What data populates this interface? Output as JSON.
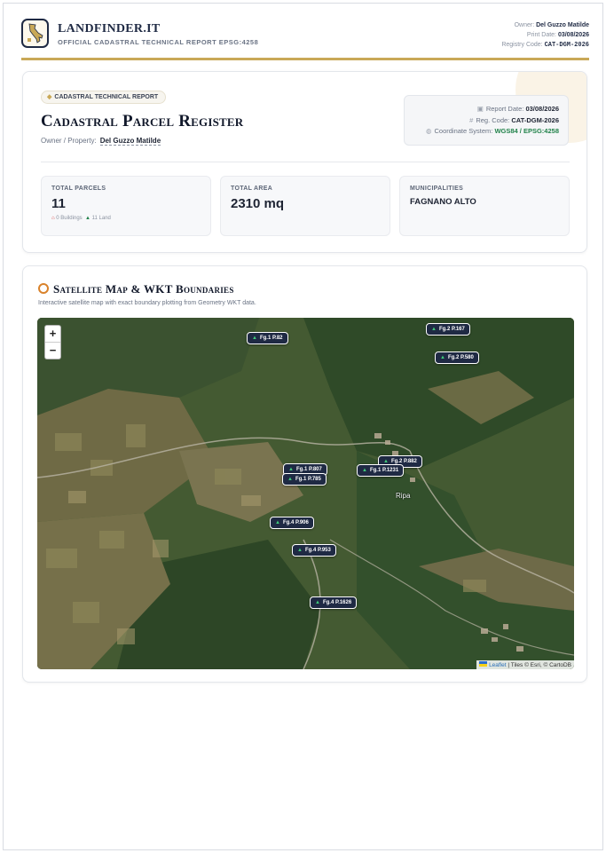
{
  "header": {
    "brand": "LANDFINDER.IT",
    "subtitle": "OFFICIAL CADASTRAL TECHNICAL REPORT EPSG:4258",
    "owner_label": "Owner:",
    "owner_value": "Del Guzzo Matilde",
    "print_label": "Print Date:",
    "print_value": "03/08/2026",
    "registry_label": "Registry Code:",
    "registry_value": "CAT-DGM-2026"
  },
  "report": {
    "badge": "CADASTRAL TECHNICAL REPORT",
    "title": "Cadastral Parcel Register",
    "owner_label": "Owner / Property:",
    "owner_value": "Del Guzzo Matilde",
    "report_date_label": "Report Date:",
    "report_date_value": "03/08/2026",
    "reg_code_label": "Reg. Code:",
    "reg_code_value": "CAT-DGM-2026",
    "coord_label": "Coordinate System:",
    "coord_value": "WGS84 / EPSG:4258"
  },
  "stats": {
    "parcels_label": "TOTAL PARCELS",
    "parcels_value": "11",
    "buildings": "0 Buildings",
    "land": "11 Land",
    "area_label": "TOTAL AREA",
    "area_value": "2310 mq",
    "municipalities_label": "MUNICIPALITIES",
    "municipalities_value": "FAGNANO ALTO"
  },
  "map_section": {
    "title": "Satellite Map & WKT Boundaries",
    "subtitle": "Interactive satellite map with exact boundary plotting from Geometry WKT data.",
    "zoom_in": "+",
    "zoom_out": "−",
    "place_name": "Ripa",
    "attribution_link": "Leaflet",
    "attribution_text": "| Tiles © Esri, © CartoDB",
    "markers": [
      "Fg.1 P.82",
      "Fg.2 P.167",
      "Fg.2 P.580",
      "Fg.1 P.807",
      "Fg.1 P.785",
      "Fg.2 P.882",
      "Fg.1 P.1231",
      "Fg.4 P.906",
      "Fg.4 P.953",
      "Fg.4 P.1626"
    ]
  },
  "colors": {
    "accent_gold": "#c9a857",
    "navy": "#1f2a44",
    "green": "#21824a",
    "red": "#d64545"
  },
  "icons": [
    "logo-italy-icon",
    "shield-icon",
    "calendar-icon",
    "hash-icon",
    "globe-icon",
    "home-icon",
    "tree-icon",
    "satellite-icon"
  ]
}
